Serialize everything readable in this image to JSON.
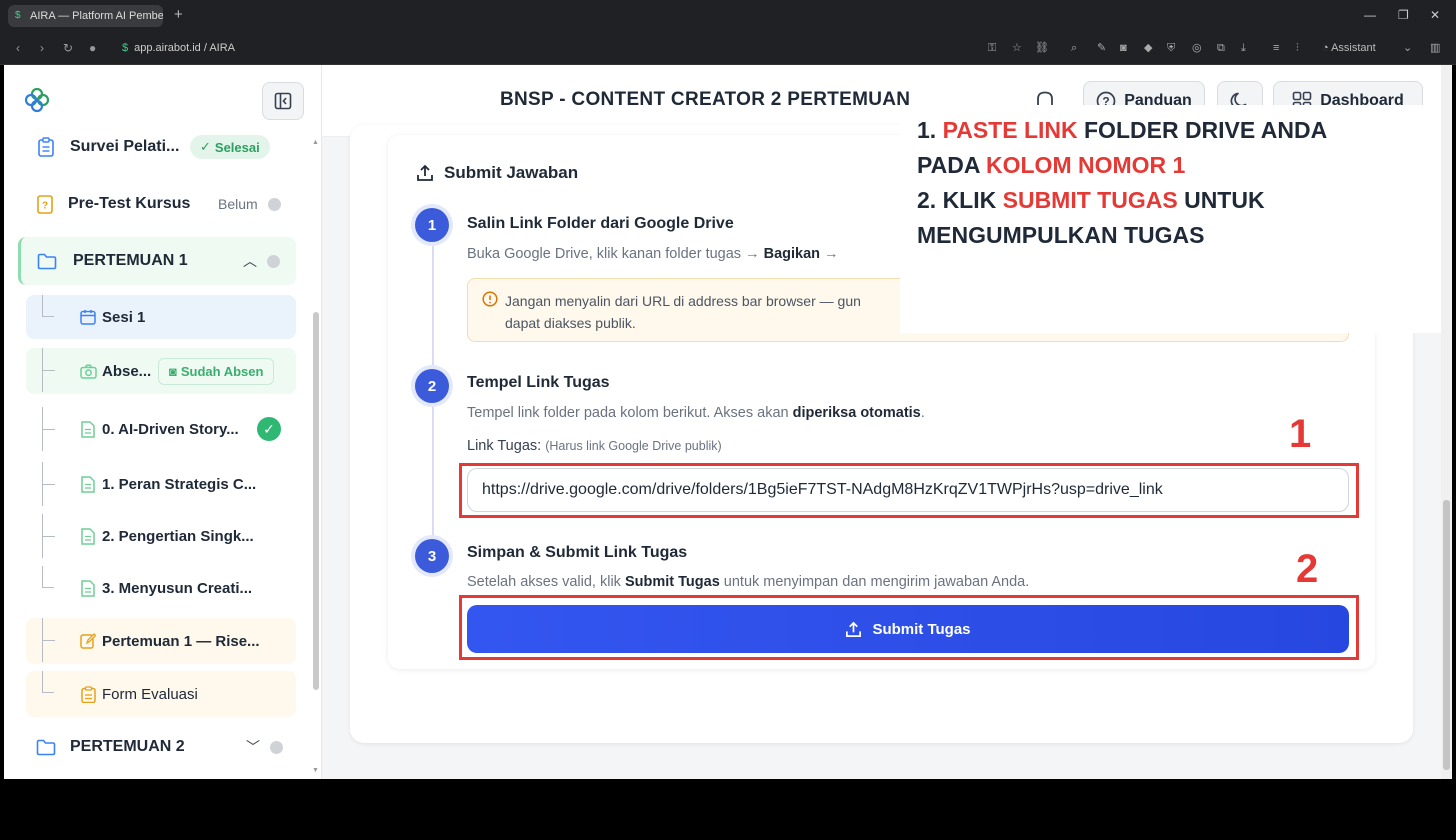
{
  "browser": {
    "tab_title": "AIRA — Platform AI Pembelajaran",
    "url": "app.airabot.id / AIRA",
    "assistant_label": "Assistant"
  },
  "header": {
    "title": "BNSP - CONTENT CREATOR 2 PERTEMUAN",
    "guide_label": "Panduan",
    "dashboard_label": "Dashboard"
  },
  "sidebar": {
    "items": [
      {
        "label": "Survei Pelati...",
        "badge": "Selesai"
      },
      {
        "label": "Pre-Test Kursus",
        "status": "Belum"
      },
      {
        "label": "PERTEMUAN 1"
      },
      {
        "label": "Sesi 1"
      },
      {
        "label": "Abse...",
        "badge": "Sudah Absen"
      },
      {
        "label": "0. AI-Driven Story..."
      },
      {
        "label": "1. Peran Strategis C..."
      },
      {
        "label": "2. Pengertian Singk..."
      },
      {
        "label": "3. Menyusun Creati..."
      },
      {
        "label": "Pertemuan 1 — Rise..."
      },
      {
        "label": "Form Evaluasi"
      },
      {
        "label": "PERTEMUAN 2"
      }
    ]
  },
  "submit_section": {
    "title": "Submit Jawaban",
    "steps": [
      {
        "num": "1",
        "title": "Salin Link Folder dari Google Drive",
        "desc_pre": "Buka Google Drive, klik kanan folder tugas → ",
        "desc_bold": "Bagikan",
        "desc_post": " →",
        "warning_line1": "Jangan menyalin dari URL di address bar browser — gun",
        "warning_line2": "dapat diakses publik."
      },
      {
        "num": "2",
        "title": "Tempel Link Tugas",
        "desc_pre": "Tempel link folder pada kolom berikut. Akses akan ",
        "desc_bold": "diperiksa otomatis",
        "desc_post": ".",
        "field_label": "Link Tugas:",
        "field_hint": "(Harus link Google Drive publik)",
        "field_value": "https://drive.google.com/drive/folders/1Bg5ieF7TST-NAdgM8HzKrqZV1TWPjrHs?usp=drive_link"
      },
      {
        "num": "3",
        "title": "Simpan & Submit Link Tugas",
        "desc_pre": "Setelah akses valid, klik ",
        "desc_bold": "Submit Tugas",
        "desc_post": " untuk menyimpan dan mengirim jawaban Anda.",
        "button_label": "Submit Tugas"
      }
    ]
  },
  "annotation": {
    "l1_a": "1. ",
    "l1_b": "PASTE LINK",
    "l1_c": " FOLDER DRIVE ANDA",
    "l2_a": "PADA ",
    "l2_b": "KOLOM NOMOR 1",
    "l3_a": "2. KLIK ",
    "l3_b": "SUBMIT TUGAS",
    "l3_c": " UNTUK",
    "l4": "MENGUMPULKAN TUGAS",
    "marker1": "1",
    "marker2": "2"
  },
  "colors": {
    "accent": "#3b5bdb",
    "annotation_red": "#e53935",
    "success": "#2e9f62"
  }
}
